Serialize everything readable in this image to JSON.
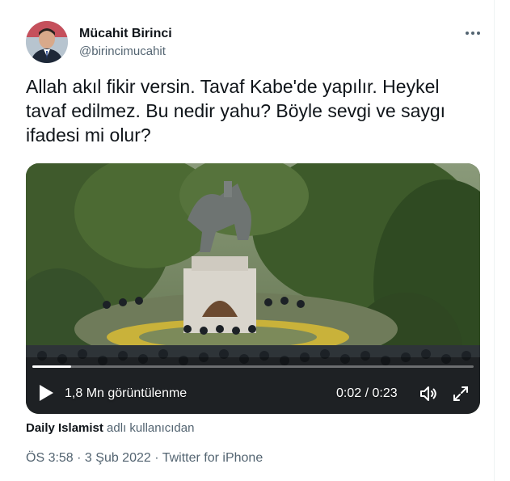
{
  "user": {
    "display_name": "Mücahit Birinci",
    "handle": "@birincimucahit"
  },
  "tweet": {
    "text": "Allah akıl fikir versin. Tavaf Kabe'de yapılır. Heykel tavaf edilmez. Bu nedir yahu? Böyle sevgi ve saygı ifadesi mi olur?"
  },
  "video": {
    "views_label": "1,8 Mn görüntülenme",
    "time_label": "0:02 / 0:23",
    "progress": 0.087
  },
  "attribution": {
    "source": "Daily Islamist",
    "suffix": " adlı kullanıcıdan"
  },
  "meta": {
    "time": "ÖS 3:58",
    "separator": " · ",
    "date": "3 Şub 2022",
    "client": "Twitter for iPhone"
  },
  "icons": {
    "more": "more-options-icon",
    "play": "play-icon",
    "volume": "volume-icon",
    "fullscreen": "fullscreen-icon"
  },
  "colors": {
    "text_primary": "#0f1419",
    "text_secondary": "#536471",
    "border": "#eff3f4"
  }
}
